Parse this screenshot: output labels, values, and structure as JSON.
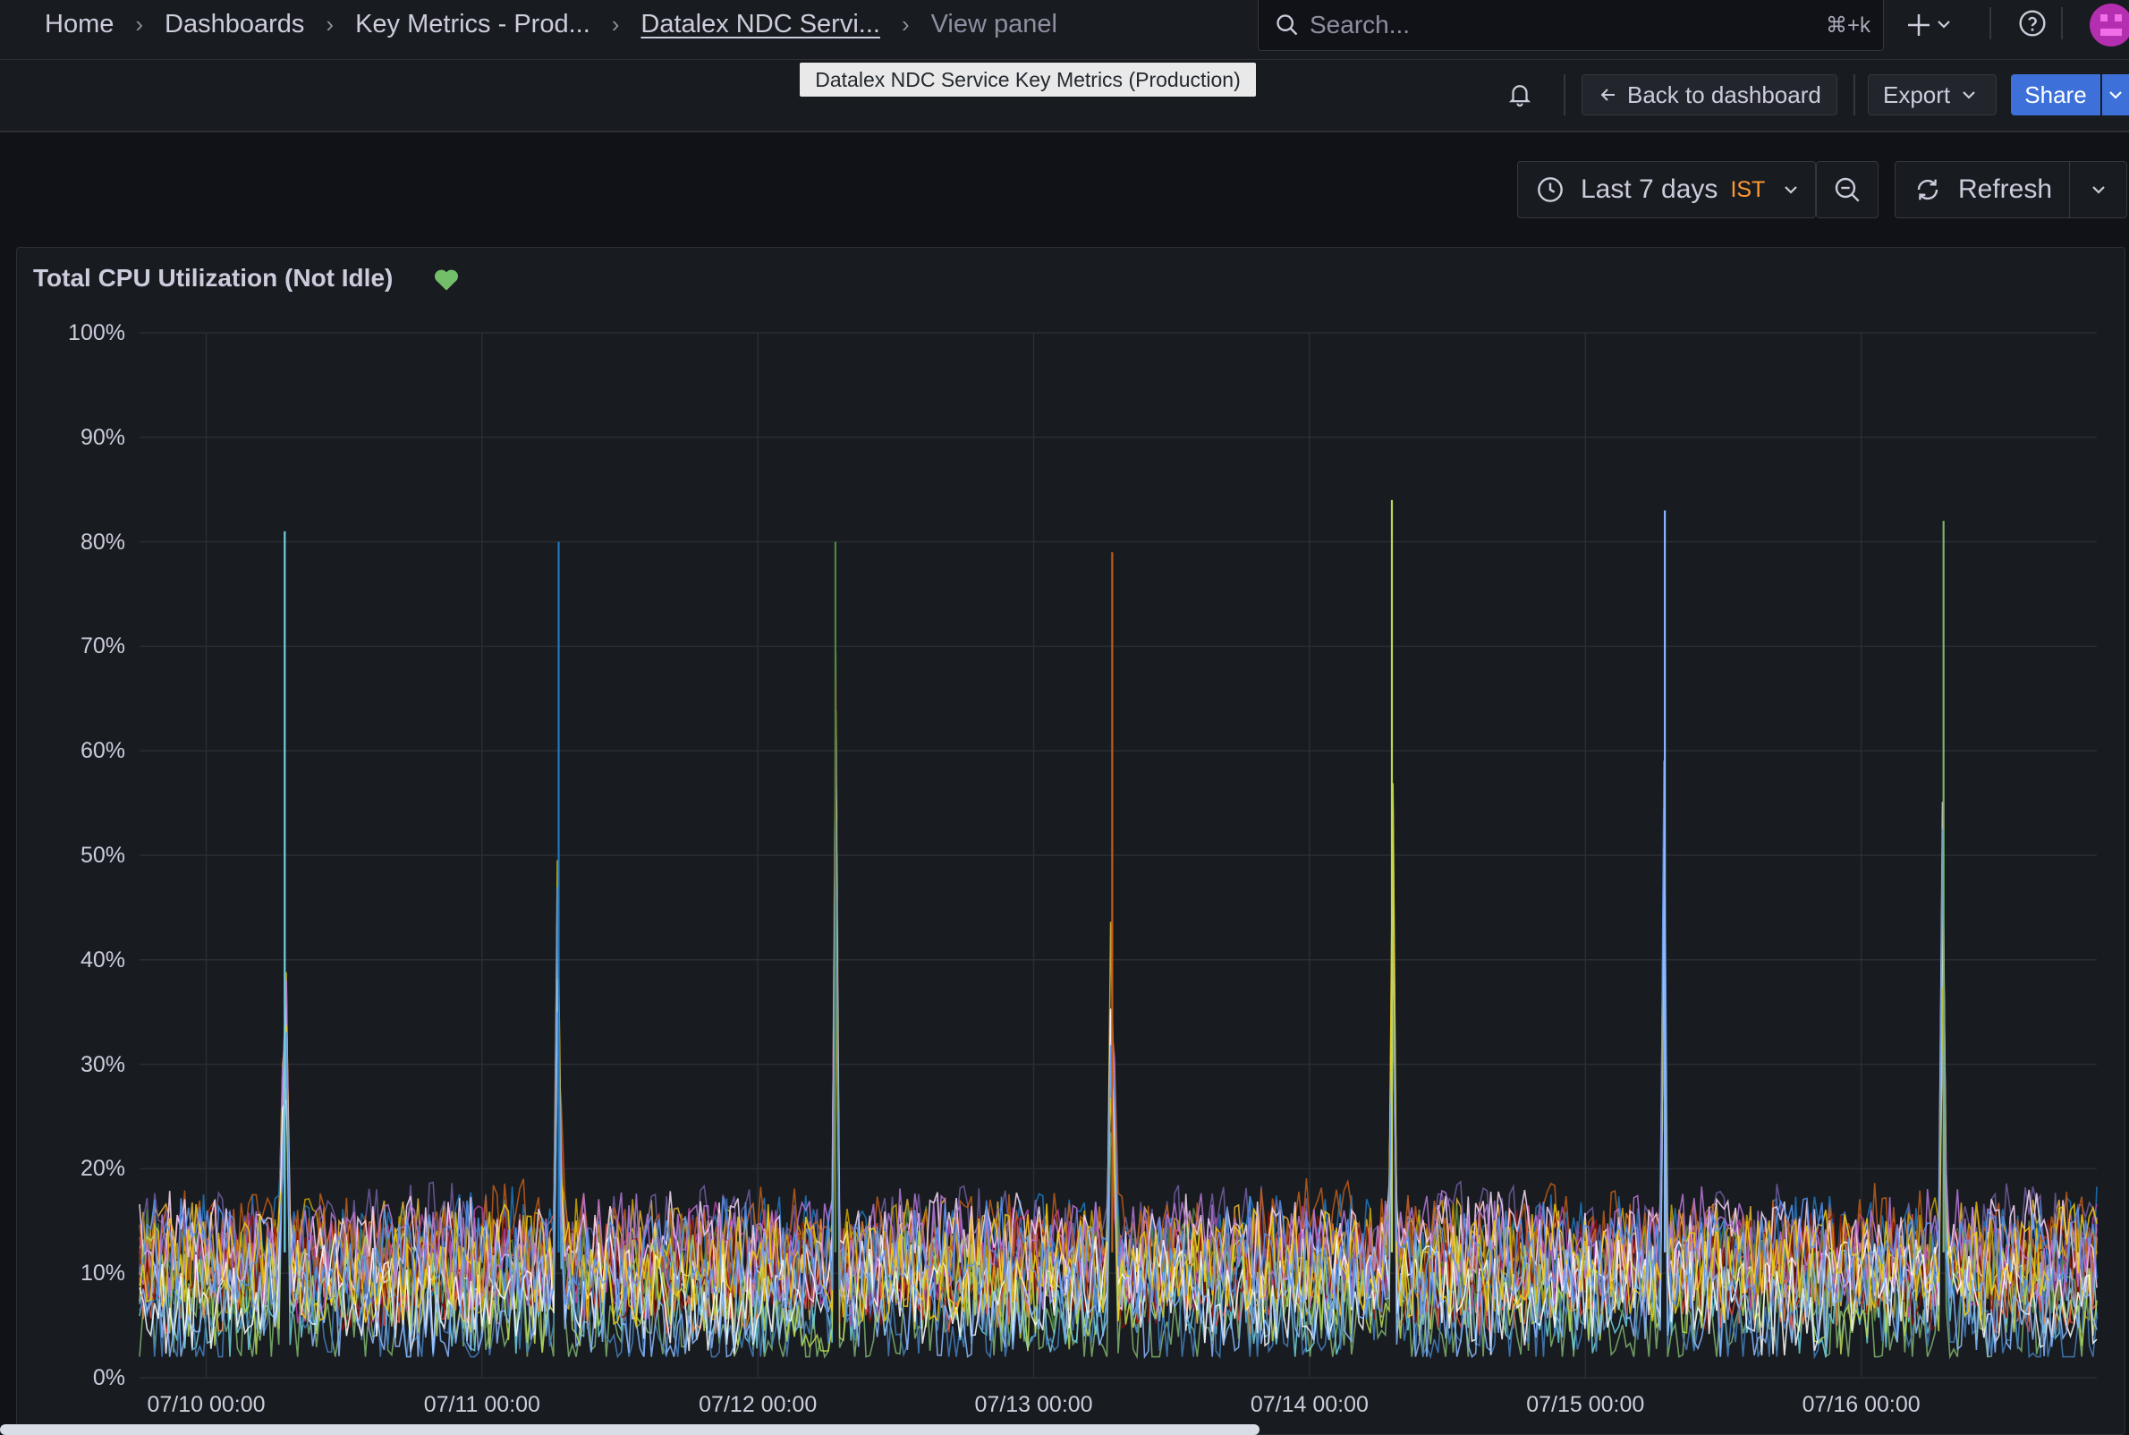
{
  "breadcrumbs": {
    "home": "Home",
    "dashboards": "Dashboards",
    "folder": "Key Metrics - Prod...",
    "dashboard": "Datalex NDC Servi...",
    "current": "View panel"
  },
  "search": {
    "placeholder": "Search...",
    "shortcut": "⌘+k"
  },
  "tooltip": "Datalex NDC Service Key Metrics (Production)",
  "toolbar": {
    "back": "Back to dashboard",
    "export": "Export",
    "share": "Share"
  },
  "time": {
    "range": "Last 7 days",
    "tz": "IST",
    "refresh": "Refresh"
  },
  "panel": {
    "title": "Total CPU Utilization (Not Idle)"
  },
  "colors": {
    "accent": "#3d71d9",
    "tz": "#ff9830",
    "heart": "#73bf69"
  },
  "chart_data": {
    "type": "line",
    "title": "Total CPU Utilization (Not Idle)",
    "ylim": [
      0,
      100
    ],
    "yticks": [
      "0%",
      "10%",
      "20%",
      "30%",
      "40%",
      "50%",
      "60%",
      "70%",
      "80%",
      "90%",
      "100%"
    ],
    "xticks": [
      "07/10 00:00",
      "07/11 00:00",
      "07/12 00:00",
      "07/13 00:00",
      "07/14 00:00",
      "07/15 00:00",
      "07/16 00:00"
    ],
    "x_range": [
      "07/09 18:12",
      "07/16 20:30"
    ],
    "grid": true,
    "legend": "none",
    "baseline_range_percent": [
      3,
      16
    ],
    "spikes": [
      {
        "time": "07/10 06:50",
        "peak": 81
      },
      {
        "time": "07/11 06:40",
        "peak": 80
      },
      {
        "time": "07/12 06:45",
        "peak": 80
      },
      {
        "time": "07/13 06:50",
        "peak": 79
      },
      {
        "time": "07/14 07:10",
        "peak": 84
      },
      {
        "time": "07/15 06:55",
        "peak": 83
      },
      {
        "time": "07/16 07:10",
        "peak": 82
      }
    ],
    "series_colors": [
      "#7eb26d",
      "#eab839",
      "#6ed0e0",
      "#ef843c",
      "#e24d42",
      "#1f78c1",
      "#ba43a9",
      "#705da0",
      "#508642",
      "#cca300",
      "#447ebc",
      "#c15c17",
      "#890f02",
      "#f9d9f9",
      "#bada55",
      "#b877d9",
      "#ffffff",
      "#8ab8ff",
      "#f2cc0c",
      "#5794f2"
    ]
  }
}
